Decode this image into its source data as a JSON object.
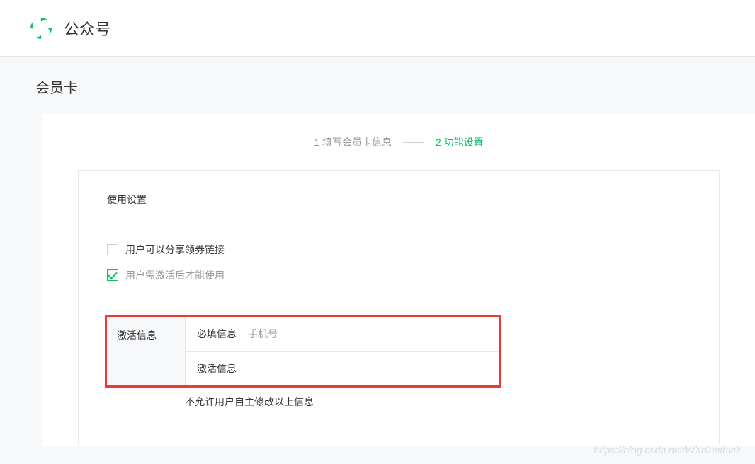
{
  "header": {
    "title": "公众号"
  },
  "page": {
    "title": "会员卡"
  },
  "steps": {
    "step1": "1 填写会员卡信息",
    "step2": "2 功能设置"
  },
  "panel": {
    "title": "使用设置"
  },
  "checkboxes": {
    "share": "用户可以分享领券链接",
    "activate": "用户需激活后才能使用"
  },
  "activation": {
    "side_label": "激活信息",
    "required_label": "必填信息",
    "required_value": "手机号",
    "info_label": "激活信息"
  },
  "note": "不允许用户自主修改以上信息",
  "watermark": "https://blog.csdn.net/WXbluethink"
}
